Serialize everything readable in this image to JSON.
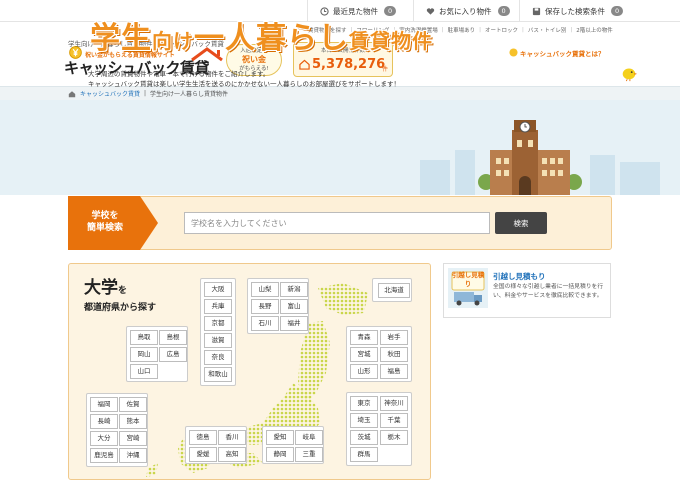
{
  "topbar": {
    "recent": {
      "label": "最近見た物件",
      "count": "0"
    },
    "favorites": {
      "label": "お気に入り物件",
      "count": "0"
    },
    "saved": {
      "label": "保存した検索条件",
      "count": "0"
    }
  },
  "subnav": [
    "賃貸物件を探す",
    "フローリング",
    "室内洗濯機置場",
    "駐車場あり",
    "オートロック",
    "バス・トイレ別",
    "2階以上の物件"
  ],
  "header": {
    "tagline": "学生向け一人暮らし賃貸物件 | キャッシュバック賃貸",
    "logo_sub": "祝い金がもらえる賃貸情報サイト",
    "logo_main": "キャッシュバック賃貸",
    "bubble_line1": "入居決定で",
    "bubble_line2": "祝い金",
    "bubble_line3": "がもらえる!",
    "count_label": "本日の公開物件数",
    "count_value": "5,378,276",
    "count_unit": "件",
    "about_link": "キャッシュバック賃貸とは？"
  },
  "breadcrumb": {
    "home": "キャッシュバック賃貸",
    "sep": "|",
    "current": "学生向け一人暮らし賃貸物件"
  },
  "hero": {
    "title_a": "学生",
    "title_b": "向け",
    "title_c": "一人暮らし",
    "title_d": "賃貸物件",
    "desc_line1": "大学周辺の賃貸物件や電車一本で行ける物件をご紹介します。",
    "desc_line2": "キャッシュバック賃貸は楽しい学生生活を送るのにかかせない一人暮らしのお部屋選びをサポートします！"
  },
  "search": {
    "tag_line1": "学校を",
    "tag_line2": "簡単検索",
    "placeholder": "学校名を入力してください",
    "button": "検索"
  },
  "map": {
    "title_big": "大学",
    "title_small": "を",
    "title_line2": "都道府県から探す",
    "groups": {
      "hokkaido": [
        "北海道"
      ],
      "tohoku": [
        "青森",
        "岩手",
        "宮城",
        "秋田",
        "山形",
        "福島"
      ],
      "kanto": [
        "東京",
        "神奈川",
        "埼玉",
        "千葉",
        "茨城",
        "栃木",
        "群馬"
      ],
      "koshinetsu": [
        "山梨",
        "新潟",
        "長野",
        "富山",
        "石川",
        "福井"
      ],
      "tokai": [
        "愛知",
        "岐阜",
        "静岡",
        "三重"
      ],
      "kinki": [
        "大阪",
        "兵庫",
        "京都",
        "滋賀",
        "奈良",
        "和歌山"
      ],
      "chugoku": [
        "鳥取",
        "島根",
        "岡山",
        "広島",
        "山口"
      ],
      "shikoku": [
        "徳島",
        "香川",
        "愛媛",
        "高知"
      ],
      "kyushu": [
        "福岡",
        "佐賀",
        "長崎",
        "熊本",
        "大分",
        "宮崎",
        "鹿児島",
        "沖縄"
      ]
    }
  },
  "promo": {
    "badge": "引越し見積り",
    "title": "引越し見積もり",
    "text": "全国の様々な引越し業者に一括見積りを行い、料金やサービスを徹底比較できます。"
  },
  "colors": {
    "accent": "#ef8f1e",
    "link": "#1e70b9",
    "band": "#fdf0d8"
  }
}
